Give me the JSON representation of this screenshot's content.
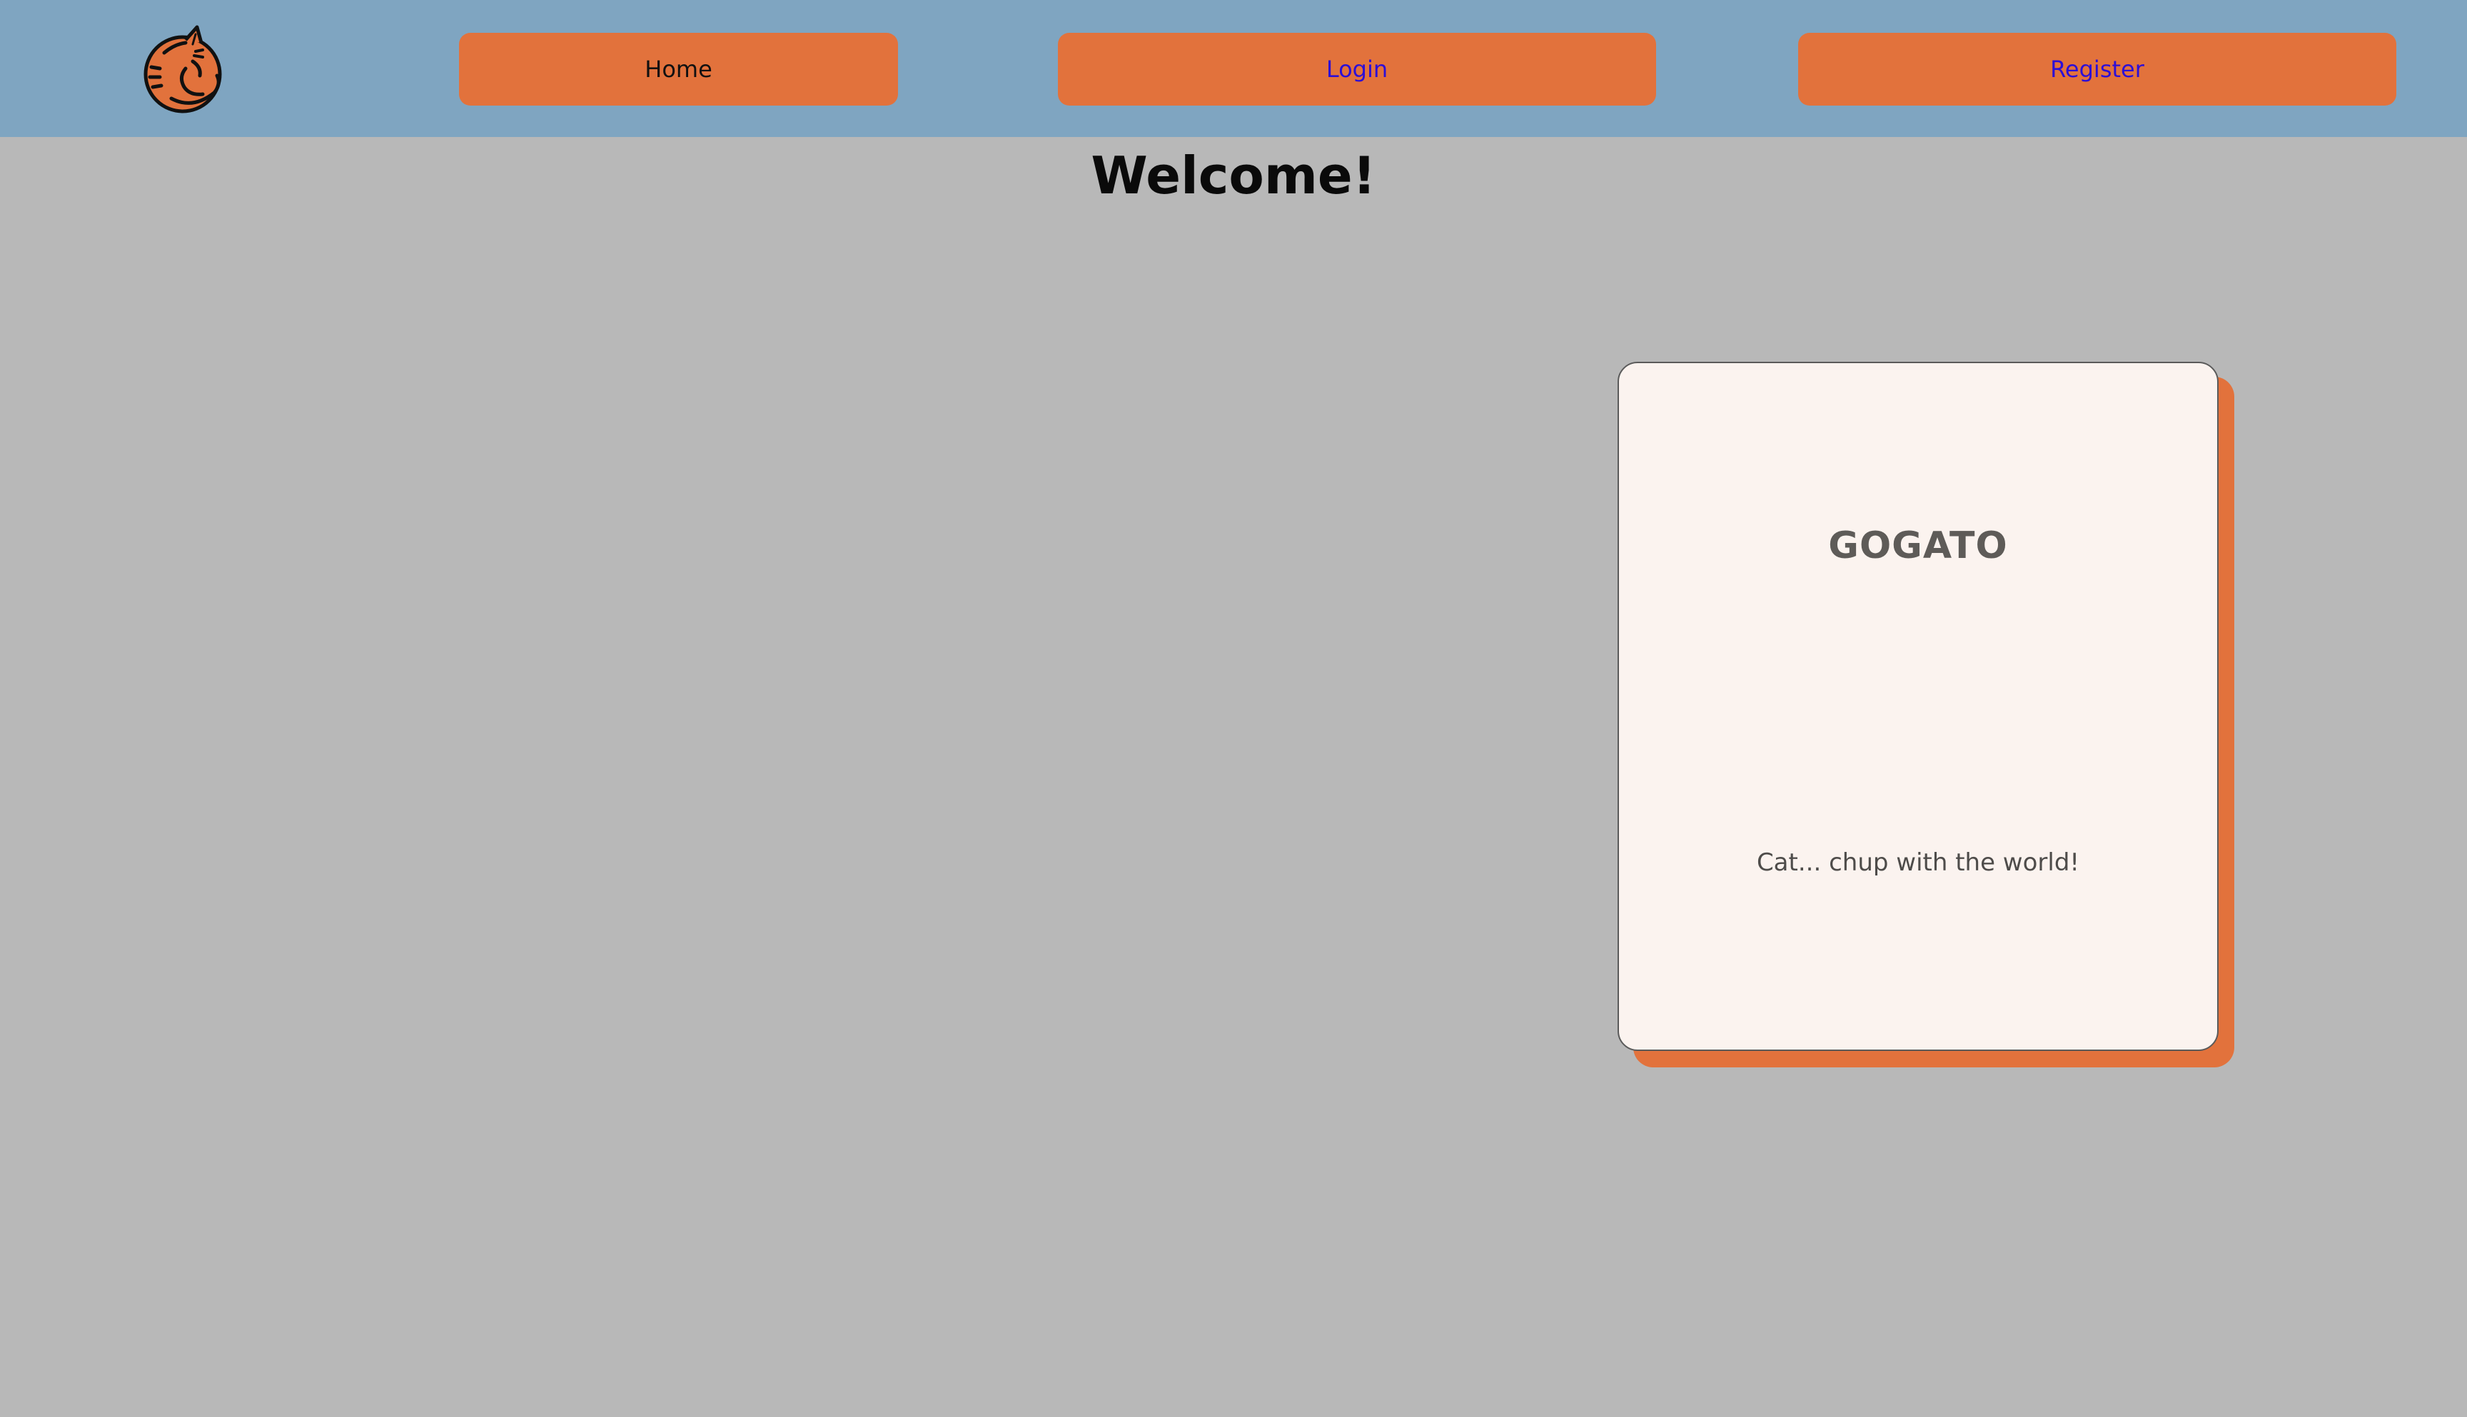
{
  "nav": {
    "logo_icon": "sleeping-cat-icon",
    "home_label": "Home",
    "login_label": "Login",
    "register_label": "Register"
  },
  "main": {
    "heading": "Welcome!"
  },
  "card": {
    "title": "GOGATO",
    "tagline": "Cat... chup with the world!"
  },
  "colors": {
    "navbar_bg": "#7fa5c1",
    "page_bg": "#b8b8b8",
    "accent_orange": "#e2723c",
    "card_bg": "#fbf3ef",
    "link_color": "#2d0fd6"
  }
}
